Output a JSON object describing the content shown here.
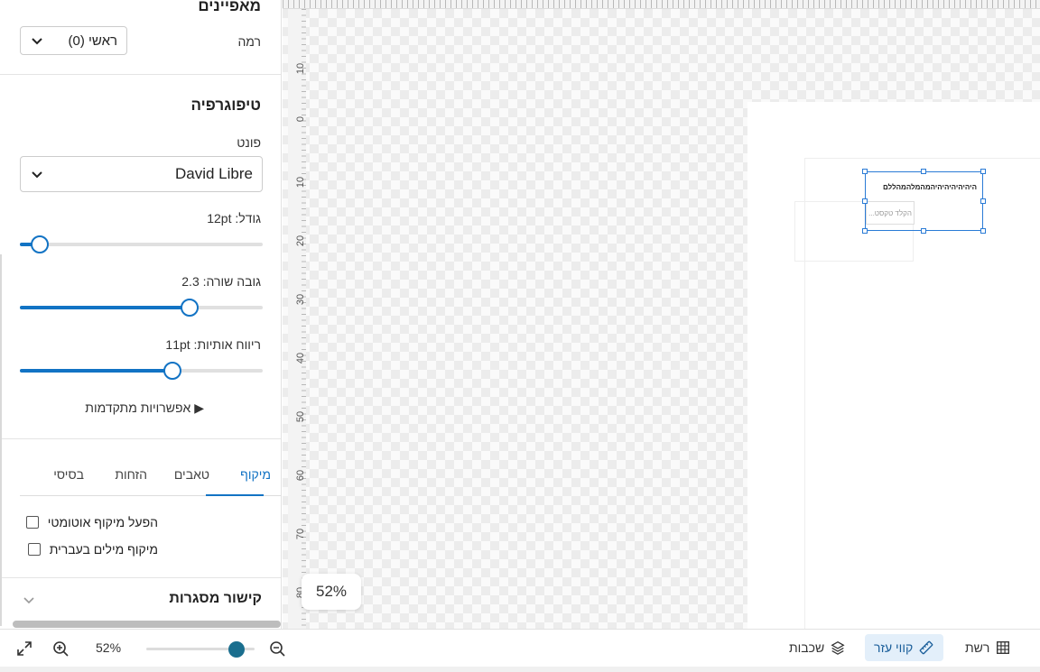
{
  "properties": {
    "heading": "מאפיינים",
    "level_label": "רמה",
    "level_value": "ראשי (0)"
  },
  "typography": {
    "heading": "טיפוגרפיה",
    "font_label": "פונט",
    "font_value": "David Libre",
    "size_label": "גודל: 12pt",
    "size_fraction": 0.08,
    "line_height_label": "גובה שורה: 2.3",
    "line_height_fraction": 0.7,
    "letter_spacing_label": "ריווח אותיות: 11pt",
    "letter_spacing_fraction": 0.63,
    "advanced_label": "▶ אפשרויות מתקדמות"
  },
  "tabs": {
    "items": [
      "מיקוף",
      "טאבים",
      "הזחות",
      "בסיסי"
    ],
    "active": "מיקוף"
  },
  "hyphenation": {
    "auto_label": "הפעל מיקוף אוטומטי",
    "hebrew_label": "מיקוף מילים בעברית"
  },
  "frame_linking": {
    "label": "קישור מסגרות"
  },
  "canvas": {
    "ruler_numbers": [
      "10",
      "0",
      "10",
      "20",
      "30",
      "40",
      "50",
      "60",
      "70",
      "80"
    ],
    "textbox_text": "היהיהיהיהיהיהמהמלהמהללם",
    "textbox_placeholder": "הקלד טקסט...",
    "zoom_badge": "52%"
  },
  "bottombar": {
    "zoom_value": "52%",
    "zoom_fraction": 0.75,
    "layers_label": "שכבות",
    "guides_label": "קווי עזר",
    "grid_label": "רשת"
  },
  "colors": {
    "accent": "#1273c4",
    "active_bg": "#e3effa"
  }
}
